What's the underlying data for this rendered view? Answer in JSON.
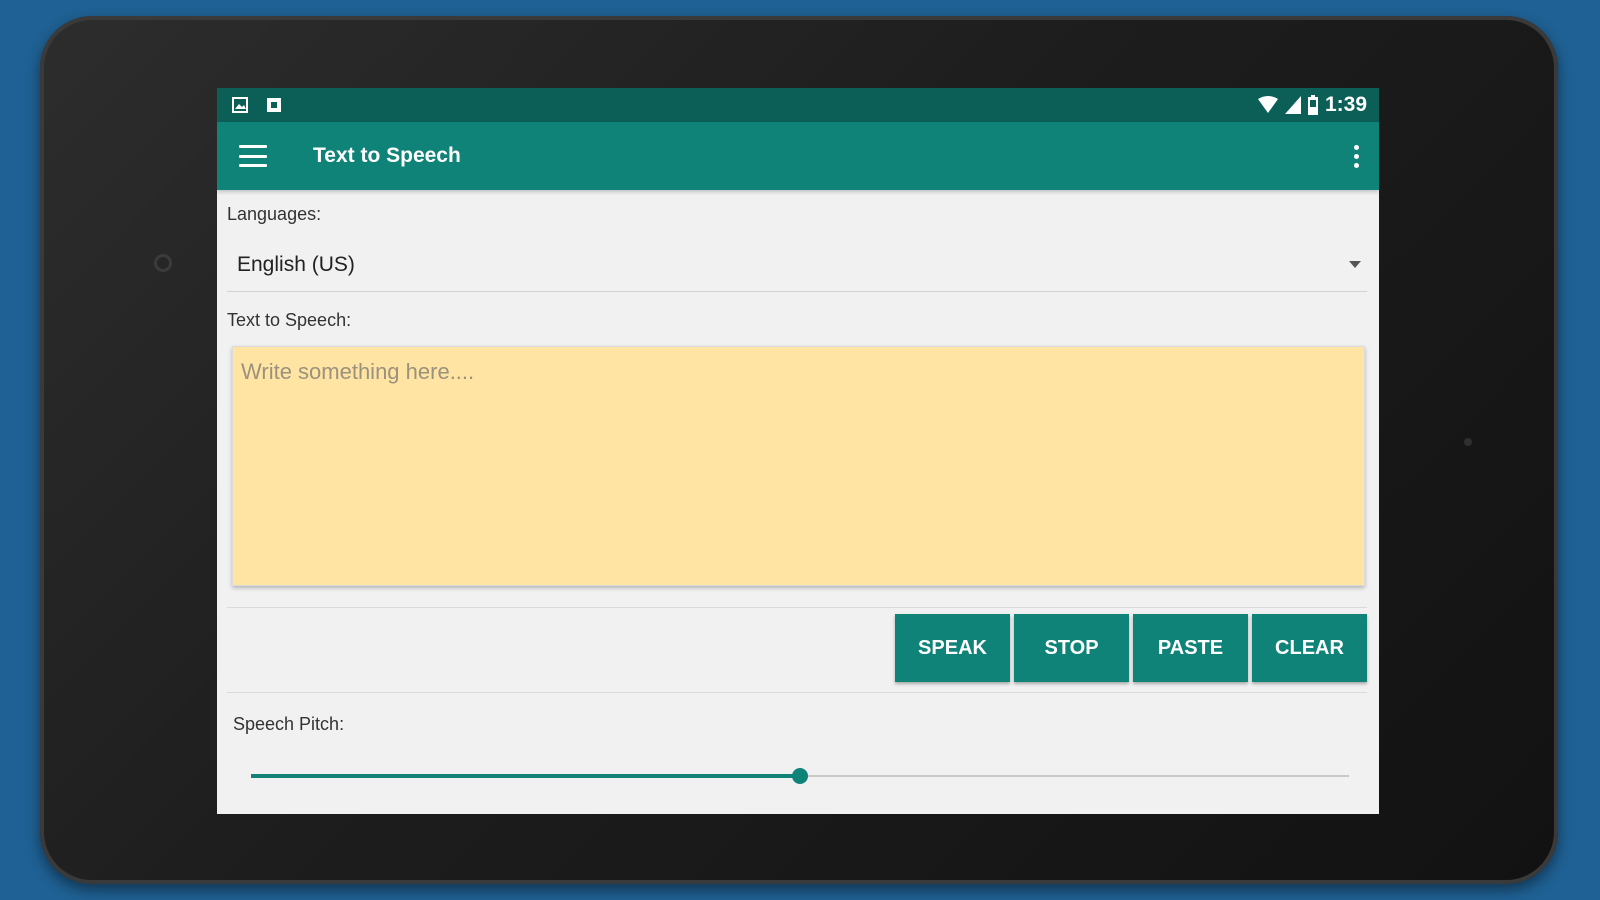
{
  "status_bar": {
    "time": "1:39"
  },
  "app_bar": {
    "title": "Text to Speech"
  },
  "languages": {
    "label": "Languages:",
    "selected": "English (US)"
  },
  "tts": {
    "label": "Text to Speech:",
    "placeholder": "Write something here....",
    "value": ""
  },
  "buttons": {
    "speak": "SPEAK",
    "stop": "STOP",
    "paste": "PASTE",
    "clear": "CLEAR"
  },
  "pitch": {
    "label": "Speech Pitch:",
    "level": 0.5
  },
  "colors": {
    "primary": "#0f8378",
    "primary_dark": "#0b5f56",
    "text_area_bg": "#ffe4a3",
    "background": "#1f6194"
  }
}
